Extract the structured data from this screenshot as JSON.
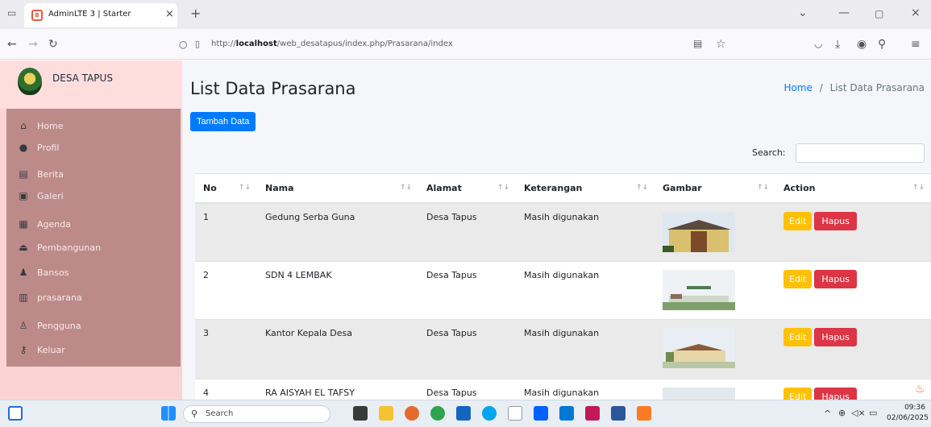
{
  "browser": {
    "tab_title": "AdminLTE 3 | Starter",
    "tab_favicon_text": "B",
    "url_host": "localhost",
    "url_prefix": "http://",
    "url_path": "/web_desatapus/index.php/Prasarana/index"
  },
  "sidebar": {
    "brand": "DESA TAPUS",
    "items": [
      {
        "label": "Home",
        "icon": "home-icon"
      },
      {
        "label": "Profil",
        "icon": "user-circle-icon"
      },
      {
        "label": "Berita",
        "icon": "newspaper-icon"
      },
      {
        "label": "Galeri",
        "icon": "image-icon"
      },
      {
        "label": "Agenda",
        "icon": "calendar-icon"
      },
      {
        "label": "Pembangunan",
        "icon": "eject-icon"
      },
      {
        "label": "Bansos",
        "icon": "user-tie-icon"
      },
      {
        "label": "prasarana",
        "icon": "building-icon"
      },
      {
        "label": "Pengguna",
        "icon": "user-icon"
      },
      {
        "label": "Keluar",
        "icon": "key-icon"
      }
    ]
  },
  "page": {
    "title": "List Data Prasarana",
    "breadcrumb_home": "Home",
    "breadcrumb_sep": "/",
    "breadcrumb_current": "List Data Prasarana",
    "add_button": "Tambah Data",
    "search_label": "Search:",
    "search_value": ""
  },
  "table": {
    "headers": [
      "No",
      "Nama",
      "Alamat",
      "Keterangan",
      "Gambar",
      "Action"
    ],
    "rows": [
      {
        "no": "1",
        "nama": "Gedung Serba Guna",
        "alamat": "Desa Tapus",
        "keterangan": "Masih digunakan",
        "edit": "Edit",
        "hapus": "Hapus"
      },
      {
        "no": "2",
        "nama": "SDN 4 LEMBAK",
        "alamat": "Desa Tapus",
        "keterangan": "Masih digunakan",
        "edit": "Edit",
        "hapus": "Hapus"
      },
      {
        "no": "3",
        "nama": "Kantor Kepala Desa",
        "alamat": "Desa Tapus",
        "keterangan": "Masih digunakan",
        "edit": "Edit",
        "hapus": "Hapus"
      },
      {
        "no": "4",
        "nama": "RA AISYAH EL TAFSY",
        "alamat": "Desa Tapus",
        "keterangan": "Masih digunakan",
        "edit": "Edit",
        "hapus": "Hapus"
      }
    ]
  },
  "taskbar": {
    "search_placeholder": "Search",
    "time": "09:36",
    "date": "02/06/2025"
  },
  "colors": {
    "primary": "#007bff",
    "warning": "#ffc107",
    "danger": "#dc3545",
    "sidebar_bg": "#fbd3d3",
    "menu_bg": "#bd8a8a"
  }
}
